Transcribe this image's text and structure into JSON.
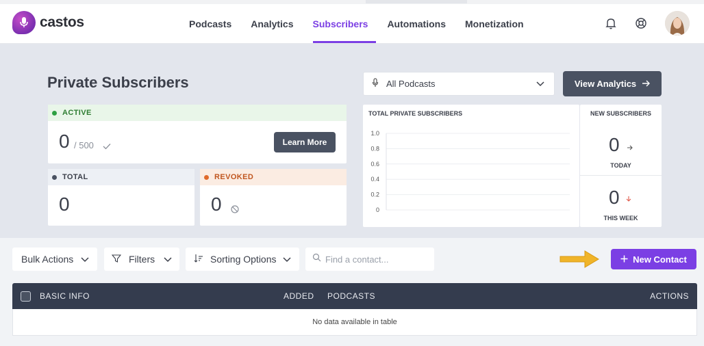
{
  "brand": {
    "name": "castos"
  },
  "nav": {
    "items": [
      {
        "label": "Podcasts"
      },
      {
        "label": "Analytics"
      },
      {
        "label": "Subscribers"
      },
      {
        "label": "Automations"
      },
      {
        "label": "Monetization"
      }
    ],
    "active": "Subscribers"
  },
  "page": {
    "title": "Private Subscribers"
  },
  "podcast_select": {
    "value": "All Podcasts"
  },
  "view_analytics": {
    "label": "View Analytics"
  },
  "cards": {
    "active": {
      "label": "ACTIVE",
      "value": "0",
      "limit": "/ 500",
      "button": "Learn More",
      "color": "#2ea043"
    },
    "total": {
      "label": "TOTAL",
      "value": "0",
      "color": "#4a5262"
    },
    "revoked": {
      "label": "REVOKED",
      "value": "0",
      "color": "#e06a2a"
    }
  },
  "chart_data": {
    "type": "line",
    "title": "TOTAL PRIVATE SUBSCRIBERS",
    "y_ticks": [
      "1.0",
      "0.8",
      "0.6",
      "0.4",
      "0.2",
      "0"
    ],
    "ylim": [
      0,
      1
    ],
    "series": []
  },
  "new_subscribers": {
    "title": "NEW SUBSCRIBERS",
    "today": {
      "value": "0",
      "label": "TODAY"
    },
    "week": {
      "value": "0",
      "label": "THIS WEEK"
    }
  },
  "toolbar": {
    "bulk_actions": "Bulk Actions",
    "filters": "Filters",
    "sorting": "Sorting Options",
    "search_placeholder": "Find a contact...",
    "new_contact": "New Contact"
  },
  "table": {
    "columns": [
      "BASIC INFO",
      "ADDED",
      "PODCASTS",
      "ACTIONS"
    ],
    "empty_message": "No data available in table"
  },
  "colors": {
    "accent": "#7b3fe4",
    "dark": "#343c4e",
    "arrow": "#f0b429"
  }
}
